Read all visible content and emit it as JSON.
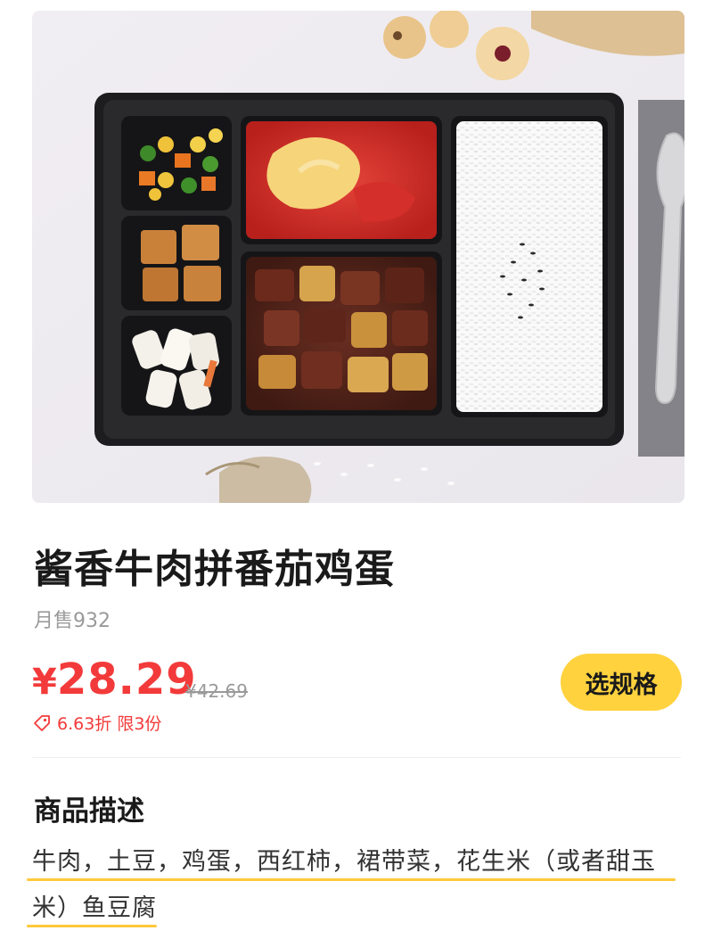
{
  "product": {
    "title": "酱香牛肉拼番茄鸡蛋",
    "sales": "月售932",
    "price_currency": "¥",
    "price_amount": "28.29",
    "original_price": "¥42.69",
    "discount_text": "6.63折 限3份",
    "spec_button_label": "选规格"
  },
  "description": {
    "heading": "商品描述",
    "line1": "牛肉，土豆，鸡蛋，西红柿，裙带菜，花生米（或者甜玉",
    "line2": "米）鱼豆腐"
  },
  "colors": {
    "price_red": "#f33a3a",
    "button_yellow": "#ffd23e",
    "underline_yellow": "#ffc93a"
  },
  "icons": {
    "discount": "price-tag-icon"
  }
}
